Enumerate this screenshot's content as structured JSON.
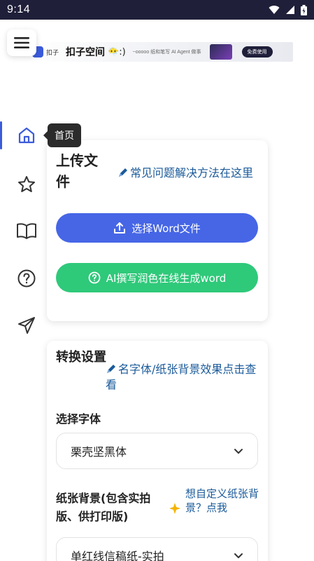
{
  "status_bar": {
    "time": "9:14"
  },
  "ad": {
    "small": "扣子",
    "title": "扣子空间",
    "emoji": "😶‍🌫️:)",
    "tiny": "~ooooo  纸和笔写 AI Agent 做事",
    "cta": "免费使用"
  },
  "rail": {
    "items": [
      {
        "name": "home",
        "icon": "home-icon"
      },
      {
        "name": "favorites",
        "icon": "star-icon"
      },
      {
        "name": "guide",
        "icon": "book-icon"
      },
      {
        "name": "help",
        "icon": "help-icon"
      },
      {
        "name": "feedback",
        "icon": "send-icon"
      }
    ],
    "tooltip": "首页"
  },
  "upload_card": {
    "title": "上传文件",
    "faq_link": "常见问题解决方法在这里",
    "select_word_button": "选择Word文件",
    "ai_button": "AI撰写润色在线生成word"
  },
  "settings_card": {
    "title": "转换设置",
    "preview_link": "名字体/纸张背景效果点击查看",
    "font_label": "选择字体",
    "font_value": "栗壳坚黑体",
    "paper_label": "纸张背景(包含实拍版、供打印版)",
    "custom_paper_hint": "想自定义纸张背景？点我",
    "paper_value": "单红线信稿纸-实拍"
  },
  "colors": {
    "accent": "#4666e6",
    "green": "#2fc97a",
    "link": "#1a5a9a"
  }
}
